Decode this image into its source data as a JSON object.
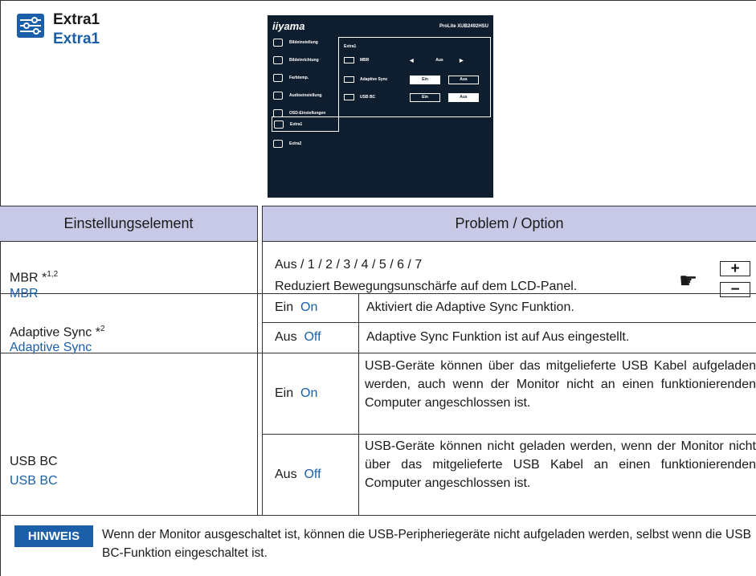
{
  "header": {
    "title": "Extra1",
    "subtitle": "Extra1",
    "icon": "extra-settings-icon"
  },
  "osd": {
    "logo": "iiyama",
    "model": "ProLite XUB2492HSU",
    "menu": [
      "Bildeinstellung",
      "Bildeinrichtung",
      "Farbtemp.",
      "Audioeinstellung",
      "OSD-Einstellungen",
      "Extra1",
      "Extra2"
    ],
    "selected": "Extra1",
    "panel_title": "Extra1",
    "rows": [
      {
        "label": "MBR",
        "value": "Aus"
      },
      {
        "label": "Adaptive Sync",
        "on": "Ein",
        "off": "Aus"
      },
      {
        "label": "USB BC",
        "on": "Ein",
        "off": "Aus"
      }
    ]
  },
  "table": {
    "col1_header": "Einstellungselement",
    "col2_header": "Problem / Option",
    "mbr": {
      "name": "MBR *",
      "sup": "1,2",
      "sub": "MBR",
      "options": "Aus / 1 / 2 / 3 / 4 / 5 / 6 / 7",
      "desc": "Reduziert Bewegungsunschärfe auf dem LCD-Panel."
    },
    "adaptive": {
      "name": "Adaptive Sync *",
      "sup": "2",
      "sub": "Adaptive Sync",
      "on_de": "Ein",
      "on_en": "On",
      "on_desc": "Aktiviert die Adaptive Sync Funktion.",
      "off_de": "Aus",
      "off_en": "Off",
      "off_desc": "Adaptive Sync Funktion ist auf Aus eingestellt."
    },
    "usb": {
      "name": "USB BC",
      "sub": "USB BC",
      "on_de": "Ein",
      "on_en": "On",
      "on_desc": "USB-Geräte können über das mitgelieferte USB Kabel aufgeladen werden, auch wenn der Monitor nicht an einen funktionierenden Computer angeschlossen ist.",
      "off_de": "Aus",
      "off_en": "Off",
      "off_desc": "USB-Geräte können nicht geladen werden, wenn der Monitor nicht über das mitgelieferte USB Kabel an einen funktionierenden Computer angeschlossen ist."
    }
  },
  "hint": {
    "badge": "HINWEIS",
    "text": "Wenn der Monitor ausgeschaltet ist, können die USB-Peripheriegeräte nicht aufgeladen werden, selbst wenn die USB BC-Funktion eingeschaltet ist."
  },
  "buttons": {
    "plus": "+",
    "minus": "−"
  }
}
